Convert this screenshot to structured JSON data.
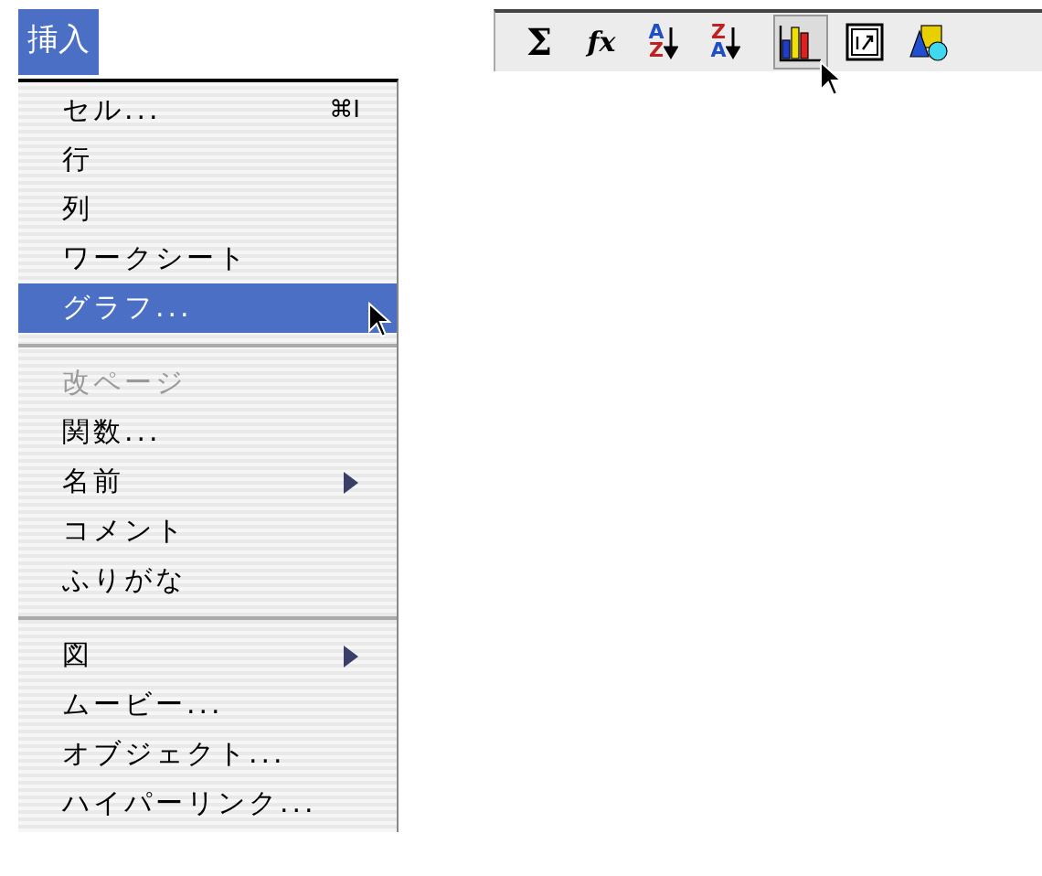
{
  "menu": {
    "title": "挿入",
    "open": true,
    "items": [
      {
        "kind": "item",
        "label": "セル...",
        "shortcut": "⌘I",
        "submenu": false,
        "disabled": false,
        "selected": false
      },
      {
        "kind": "item",
        "label": "行",
        "submenu": false,
        "disabled": false,
        "selected": false
      },
      {
        "kind": "item",
        "label": "列",
        "submenu": false,
        "disabled": false,
        "selected": false
      },
      {
        "kind": "item",
        "label": "ワークシート",
        "submenu": false,
        "disabled": false,
        "selected": false
      },
      {
        "kind": "item",
        "label": "グラフ...",
        "submenu": false,
        "disabled": false,
        "selected": true
      },
      {
        "kind": "separator"
      },
      {
        "kind": "item",
        "label": "改ページ",
        "submenu": false,
        "disabled": true,
        "selected": false
      },
      {
        "kind": "item",
        "label": "関数...",
        "submenu": false,
        "disabled": false,
        "selected": false
      },
      {
        "kind": "item",
        "label": "名前",
        "submenu": true,
        "disabled": false,
        "selected": false
      },
      {
        "kind": "item",
        "label": "コメント",
        "submenu": false,
        "disabled": false,
        "selected": false
      },
      {
        "kind": "item",
        "label": "ふりがな",
        "submenu": false,
        "disabled": false,
        "selected": false
      },
      {
        "kind": "separator"
      },
      {
        "kind": "item",
        "label": "図",
        "submenu": true,
        "disabled": false,
        "selected": false
      },
      {
        "kind": "item",
        "label": "ムービー...",
        "submenu": false,
        "disabled": false,
        "selected": false
      },
      {
        "kind": "item",
        "label": "オブジェクト...",
        "submenu": false,
        "disabled": false,
        "selected": false
      },
      {
        "kind": "item",
        "label": "ハイパーリンク...",
        "submenu": false,
        "disabled": false,
        "selected": false
      }
    ]
  },
  "toolbar": [
    {
      "kind": "glyph",
      "label": "Σ",
      "selected": false
    },
    {
      "kind": "glyph",
      "label": "fx",
      "selected": false
    },
    {
      "kind": "sort",
      "top": "A",
      "bottom": "Z",
      "selected": false
    },
    {
      "kind": "sort",
      "top": "Z",
      "bottom": "A",
      "selected": false
    },
    {
      "kind": "chart",
      "selected": true
    },
    {
      "kind": "form",
      "selected": false
    },
    {
      "kind": "art",
      "selected": false
    }
  ]
}
